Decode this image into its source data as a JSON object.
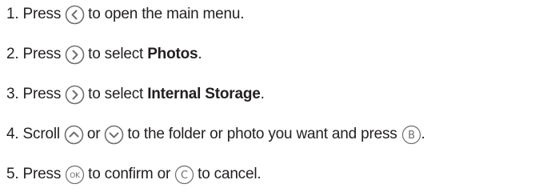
{
  "steps": [
    {
      "number": "1.",
      "before": "Press",
      "button": "left-arrow-button",
      "after": "to open the main menu."
    },
    {
      "number": "2.",
      "before": "Press",
      "button": "right-arrow-button",
      "after": "to select",
      "bold": "Photos",
      "end": "."
    },
    {
      "number": "3.",
      "before": "Press",
      "button": "right-arrow-button",
      "after": "to select",
      "bold": "Internal Storage",
      "end": "."
    },
    {
      "number": "4.",
      "before": "Scroll",
      "button": "up-arrow-button",
      "middle": "or",
      "button2": "down-arrow-button",
      "after": "to the folder or photo you want and press",
      "button3": "b-button",
      "button3_label": "B",
      "end": "."
    },
    {
      "number": "5.",
      "before": "Press",
      "button": "ok-button",
      "button_label": "OK",
      "after": "to confirm or",
      "button2": "c-button",
      "button2_label": "C",
      "end": "to cancel."
    }
  ],
  "colors": {
    "text": "#231f20",
    "icon": "#6d6e71"
  }
}
